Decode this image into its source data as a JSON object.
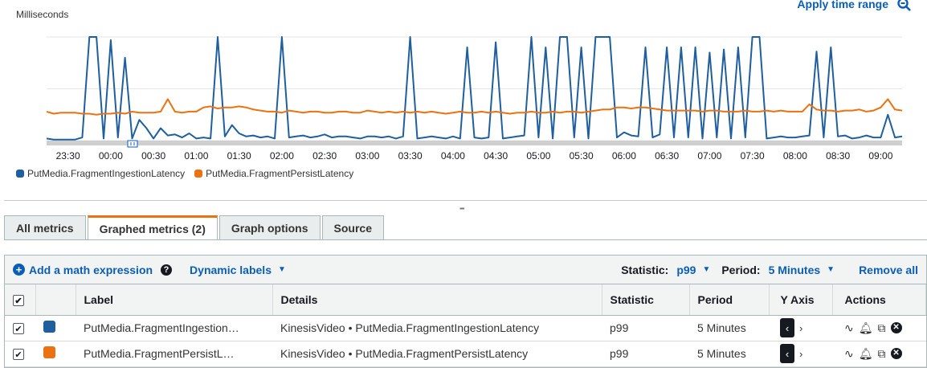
{
  "chart": {
    "y_unit": "Milliseconds",
    "apply_time_range": "Apply time range",
    "ticks": [
      "23:30",
      "00:00",
      "00:30",
      "01:00",
      "01:30",
      "02:00",
      "02:30",
      "03:00",
      "03:30",
      "04:00",
      "04:30",
      "05:00",
      "05:30",
      "06:00",
      "06:30",
      "07:00",
      "07:30",
      "08:00",
      "08:30",
      "09:00"
    ]
  },
  "chart_data": {
    "type": "line",
    "ylabel": "Milliseconds",
    "grid": true,
    "legend_position": "bottom-left",
    "x": [
      "23:15",
      "23:20",
      "23:25",
      "23:30",
      "23:35",
      "23:40",
      "23:45",
      "23:50",
      "23:55",
      "00:00",
      "00:05",
      "00:10",
      "00:15",
      "00:20",
      "00:25",
      "00:30",
      "00:35",
      "00:40",
      "00:45",
      "00:50",
      "00:55",
      "01:00",
      "01:05",
      "01:10",
      "01:15",
      "01:20",
      "01:25",
      "01:30",
      "01:35",
      "01:40",
      "01:45",
      "01:50",
      "01:55",
      "02:00",
      "02:05",
      "02:10",
      "02:15",
      "02:20",
      "02:25",
      "02:30",
      "02:35",
      "02:40",
      "02:45",
      "02:50",
      "02:55",
      "03:00",
      "03:05",
      "03:10",
      "03:15",
      "03:20",
      "03:25",
      "03:30",
      "03:35",
      "03:40",
      "03:45",
      "03:50",
      "03:55",
      "04:00",
      "04:05",
      "04:10",
      "04:15",
      "04:20",
      "04:25",
      "04:30",
      "04:35",
      "04:40",
      "04:45",
      "04:50",
      "04:55",
      "05:00",
      "05:05",
      "05:10",
      "05:15",
      "05:20",
      "05:25",
      "05:30",
      "05:35",
      "05:40",
      "05:45",
      "05:50",
      "05:55",
      "06:00",
      "06:05",
      "06:10",
      "06:15",
      "06:20",
      "06:25",
      "06:30",
      "06:35",
      "06:40",
      "06:45",
      "06:50",
      "06:55",
      "07:00",
      "07:05",
      "07:10",
      "07:15",
      "07:20",
      "07:25",
      "07:30",
      "07:35",
      "07:40",
      "07:45",
      "07:50",
      "07:55",
      "08:00",
      "08:05",
      "08:10",
      "08:15",
      "08:20",
      "08:25",
      "08:30",
      "08:35",
      "08:40",
      "08:45",
      "08:50",
      "08:55",
      "09:00",
      "09:05",
      "09:10",
      "09:15"
    ],
    "series": [
      {
        "name": "PutMedia.FragmentIngestionLatency",
        "color": "#1f5fa0",
        "values": [
          2,
          1,
          1,
          1,
          1,
          3,
          100,
          100,
          2,
          97,
          3,
          80,
          2,
          20,
          12,
          2,
          12,
          5,
          6,
          3,
          7,
          2,
          3,
          2,
          100,
          4,
          15,
          7,
          4,
          5,
          3,
          4,
          2,
          100,
          3,
          4,
          5,
          3,
          4,
          6,
          3,
          4,
          4,
          3,
          2,
          4,
          4,
          3,
          4,
          2,
          4,
          100,
          2,
          3,
          4,
          3,
          2,
          4,
          2,
          90,
          3,
          2,
          3,
          95,
          2,
          3,
          4,
          5,
          100,
          3,
          90,
          2,
          100,
          100,
          3,
          90,
          2,
          100,
          100,
          100,
          3,
          8,
          5,
          4,
          90,
          3,
          6,
          90,
          3,
          90,
          3,
          90,
          2,
          85,
          3,
          88,
          2,
          90,
          3,
          100,
          100,
          2,
          3,
          4,
          3,
          3,
          4,
          5,
          86,
          3,
          90,
          4,
          5,
          2,
          3,
          5,
          3,
          3,
          25,
          3,
          4
        ]
      },
      {
        "name": "PutMedia.FragmentPersistLatency",
        "color": "#ec7211",
        "values": [
          28,
          26,
          27,
          27,
          27,
          26,
          26,
          25,
          26,
          26,
          27,
          26,
          28,
          27,
          27,
          27,
          28,
          40,
          28,
          27,
          28,
          28,
          32,
          33,
          31,
          32,
          32,
          33,
          32,
          30,
          29,
          28,
          28,
          27,
          29,
          28,
          27,
          28,
          28,
          27,
          27,
          28,
          28,
          27,
          27,
          29,
          28,
          27,
          28,
          27,
          28,
          27,
          28,
          27,
          28,
          27,
          26,
          27,
          28,
          27,
          27,
          28,
          27,
          28,
          27,
          26,
          27,
          27,
          28,
          27,
          27,
          28,
          27,
          28,
          28,
          27,
          28,
          29,
          30,
          30,
          32,
          32,
          31,
          32,
          32,
          31,
          30,
          29,
          29,
          29,
          29,
          29,
          28,
          29,
          29,
          28,
          28,
          28,
          29,
          28,
          28,
          29,
          28,
          29,
          28,
          28,
          28,
          35,
          30,
          29,
          29,
          28,
          29,
          29,
          30,
          28,
          29,
          32,
          40,
          30,
          29
        ]
      }
    ]
  },
  "legend": [
    {
      "label": "PutMedia.FragmentIngestionLatency",
      "color": "#1f5fa0"
    },
    {
      "label": "PutMedia.FragmentPersistLatency",
      "color": "#ec7211"
    }
  ],
  "tabs": [
    {
      "label": "All metrics",
      "active": false
    },
    {
      "label": "Graphed metrics (2)",
      "active": true
    },
    {
      "label": "Graph options",
      "active": false
    },
    {
      "label": "Source",
      "active": false
    }
  ],
  "toolbar": {
    "add_math": "Add a math expression",
    "dynamic_labels": "Dynamic labels",
    "statistic_label": "Statistic:",
    "statistic_value": "p99",
    "period_label": "Period:",
    "period_value": "5 Minutes",
    "remove_all": "Remove all"
  },
  "table": {
    "headers": [
      "Label",
      "Details",
      "Statistic",
      "Period",
      "Y Axis",
      "Actions"
    ],
    "rows": [
      {
        "color": "#1f5fa0",
        "label": "PutMedia.FragmentIngestion…",
        "namespace": "KinesisVideo",
        "metric": "PutMedia.FragmentIngestionLatency",
        "statistic": "p99",
        "period": "5 Minutes"
      },
      {
        "color": "#ec7211",
        "label": "PutMedia.FragmentPersistL…",
        "namespace": "KinesisVideo",
        "metric": "PutMedia.FragmentPersistLatency",
        "statistic": "p99",
        "period": "5 Minutes"
      }
    ]
  }
}
